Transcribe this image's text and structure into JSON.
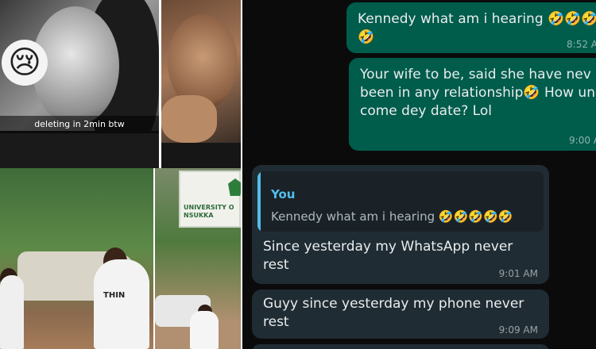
{
  "collage": {
    "snap_caption": "deleting in 2min btw",
    "shirt_text": "THIN",
    "sign_text": "UNIVERSITY O\nNSUKKA",
    "sad_emoji": "😢"
  },
  "chat": {
    "messages": [
      {
        "direction": "outgoing",
        "text": "Kennedy what am i hearing 🤣🤣🤣🤣",
        "time": "8:52 A"
      },
      {
        "direction": "outgoing",
        "text": "Your wife to be, said she have nev been in any relationship🤣 How una come dey date? Lol",
        "time": "9:00 A"
      },
      {
        "direction": "incoming",
        "quote_author": "You",
        "quote_text": "Kennedy what am i hearing 🤣🤣🤣🤣🤣",
        "text": "Since yesterday my WhatsApp never rest",
        "time": "9:01 AM"
      },
      {
        "direction": "incoming",
        "text": "Guyy since yesterday my phone never rest",
        "time": "9:09 AM"
      }
    ]
  },
  "colors": {
    "chat_background": "#0b0b0b",
    "outgoing_bubble": "#005c4b",
    "incoming_bubble": "#202c33",
    "quote_accent": "#53bdeb"
  }
}
